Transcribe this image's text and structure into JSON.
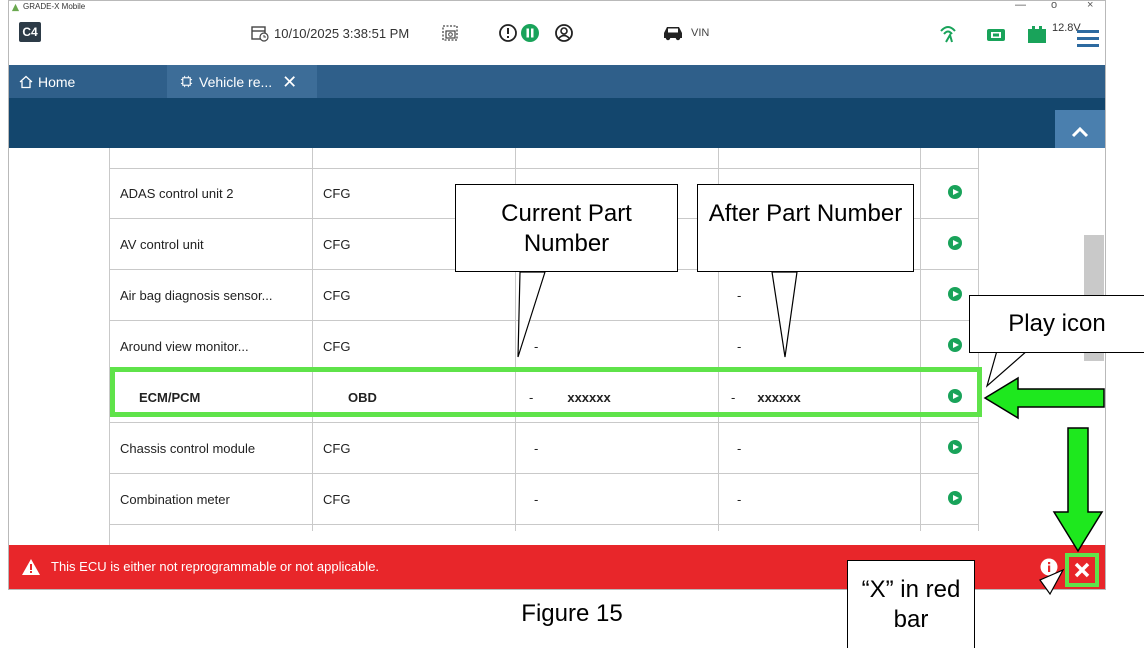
{
  "window": {
    "title": "GRADE-X Mobile"
  },
  "toolbar": {
    "app_badge": "C4",
    "datetime": "10/10/2025 3:38:51 PM",
    "vin_label": "VIN",
    "battery_voltage": "12.8V"
  },
  "tabs": [
    {
      "label": "Home"
    },
    {
      "label": "Vehicle re..."
    }
  ],
  "table": {
    "rows": [
      {
        "name": "ADAS control unit 2",
        "type": "CFG",
        "current": "",
        "after": ""
      },
      {
        "name": "AV control unit",
        "type": "CFG",
        "current": "",
        "after": ""
      },
      {
        "name": "Air bag diagnosis sensor...",
        "type": "CFG",
        "current": "",
        "after": "-"
      },
      {
        "name": "Around view monitor...",
        "type": "CFG",
        "current": "-",
        "after": "-"
      },
      {
        "name": "ECM/PCM",
        "type": "OBD",
        "current": "-",
        "current_value": "xxxxxx",
        "after": "-",
        "after_value": "xxxxxx"
      },
      {
        "name": "Chassis control module",
        "type": "CFG",
        "current": "-",
        "after": "-"
      },
      {
        "name": "Combination meter",
        "type": "CFG",
        "current": "-",
        "after": "-"
      }
    ]
  },
  "error_bar": {
    "message": "This ECU is either not reprogrammable or not applicable."
  },
  "callouts": {
    "current_part": "Current Part Number",
    "after_part": "After Part Number",
    "play_icon": "Play icon",
    "x_in_red_bar": "“X” in red bar"
  },
  "figure_caption": "Figure 15",
  "colors": {
    "highlight_green": "#5fe34a",
    "arrow_green": "#1ee81e",
    "error_red": "#e8262a",
    "header_blue": "#13466d",
    "play_green": "#19a35a"
  }
}
